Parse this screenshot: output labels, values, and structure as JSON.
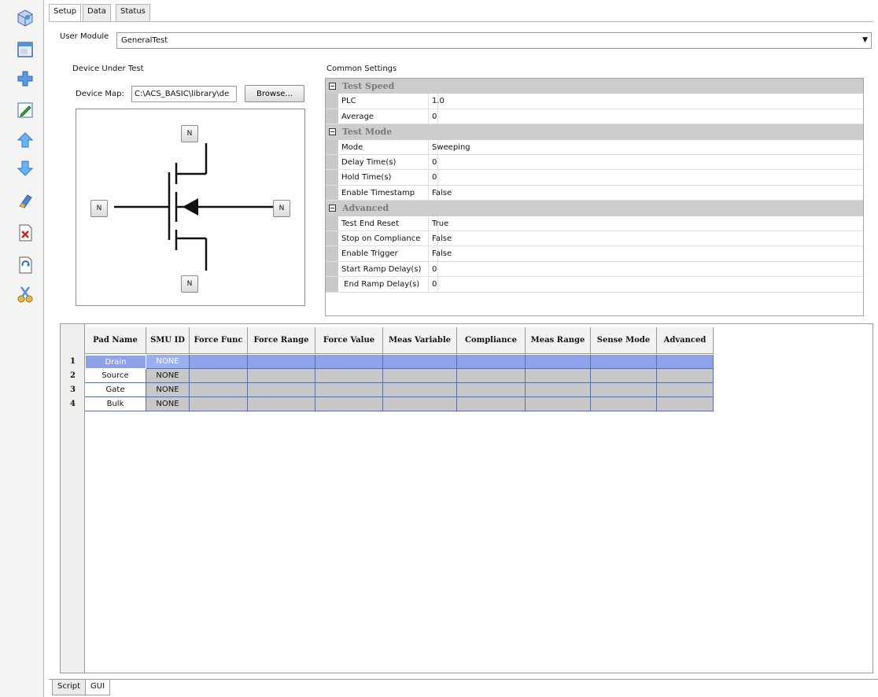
{
  "toolbar": {
    "icons": [
      "package-icon",
      "window-icon",
      "plus-icon",
      "edit-icon",
      "arrow-up-icon",
      "arrow-down-icon",
      "eraser-icon",
      "delete-document-icon",
      "copy-document-icon",
      "scissors-icon"
    ]
  },
  "tabs_top": [
    "Setup",
    "Data",
    "Status"
  ],
  "user_module": {
    "label": "User Module",
    "value": "GeneralTest"
  },
  "device_under_test": {
    "label": "Device Under Test",
    "device_map_label": "Device Map:",
    "device_map_value": "C:\\ACS_BASIC\\library\\de",
    "browse_label": "Browse...",
    "pins": [
      "N",
      "N",
      "N",
      "N"
    ]
  },
  "common_settings": {
    "label": "Common Settings",
    "categories": [
      {
        "name": "Test Speed",
        "props": [
          {
            "name": "PLC",
            "value": "1.0"
          },
          {
            "name": "Average",
            "value": "0"
          }
        ]
      },
      {
        "name": "Test Mode",
        "props": [
          {
            "name": "Mode",
            "value": "Sweeping"
          },
          {
            "name": "Delay Time(s)",
            "value": "0"
          },
          {
            "name": "Hold Time(s)",
            "value": "0"
          },
          {
            "name": "Enable Timestamp",
            "value": "False"
          }
        ]
      },
      {
        "name": "Advanced",
        "props": [
          {
            "name": "Test End Reset",
            "value": "True"
          },
          {
            "name": "Stop on Compliance",
            "value": "False"
          },
          {
            "name": "Enable Trigger",
            "value": "False"
          },
          {
            "name": "Start Ramp Delay(s)",
            "value": "0"
          },
          {
            "name": " End Ramp Delay(s)",
            "value": "0"
          }
        ]
      }
    ]
  },
  "pad_table": {
    "headers": [
      "Pad Name",
      "SMU ID",
      "Force Func",
      "Force Range",
      "Force Value",
      "Meas Variable",
      "Compliance",
      "Meas Range",
      "Sense Mode",
      "Advanced"
    ],
    "rows": [
      {
        "num": "1",
        "pad": "Drain",
        "smu": "NONE",
        "selected": true
      },
      {
        "num": "2",
        "pad": "Source",
        "smu": "NONE",
        "selected": false
      },
      {
        "num": "3",
        "pad": "Gate",
        "smu": "NONE",
        "selected": false
      },
      {
        "num": "4",
        "pad": "Bulk",
        "smu": "NONE",
        "selected": false
      }
    ]
  },
  "tabs_bottom": [
    "Script",
    "GUI"
  ]
}
